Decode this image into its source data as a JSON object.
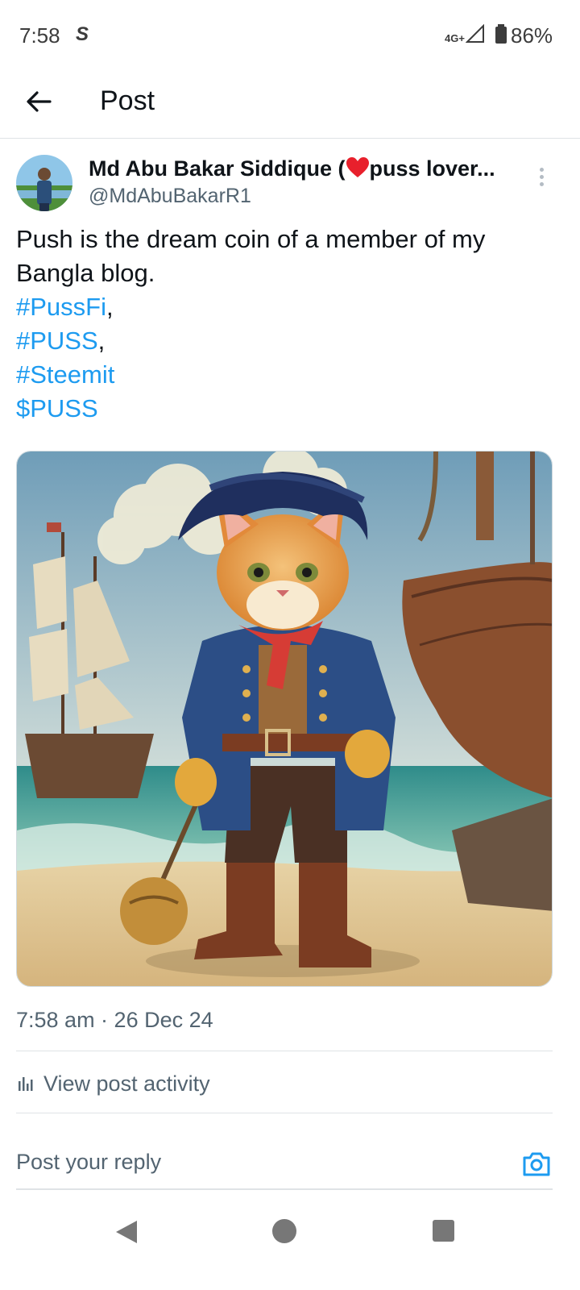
{
  "status_bar": {
    "time": "7:58",
    "network": "4G+",
    "battery": "86%"
  },
  "header": {
    "title": "Post"
  },
  "tweet": {
    "author_name_prefix": "Md Abu Bakar Siddique (",
    "author_name_suffix": "puss lover...",
    "handle": "@MdAbuBakarR1",
    "text": "Push is the dream coin of a member of my Bangla blog.",
    "tags": [
      {
        "tag": "#PussFi",
        "sep": ","
      },
      {
        "tag": "#PUSS",
        "sep": ","
      },
      {
        "tag": "#Steemit",
        "sep": ""
      },
      {
        "tag": "$PUSS",
        "sep": ""
      }
    ],
    "timestamp": "7:58 am · 26 Dec 24"
  },
  "activity": {
    "label": "View post activity"
  },
  "reply": {
    "placeholder": "Post your reply"
  },
  "colors": {
    "link": "#1d9bf0",
    "text": "#0f1419",
    "secondary": "#536471"
  },
  "icons": [
    "back-arrow-icon",
    "more-vertical-icon",
    "heart-icon",
    "activity-chart-icon",
    "camera-icon"
  ]
}
